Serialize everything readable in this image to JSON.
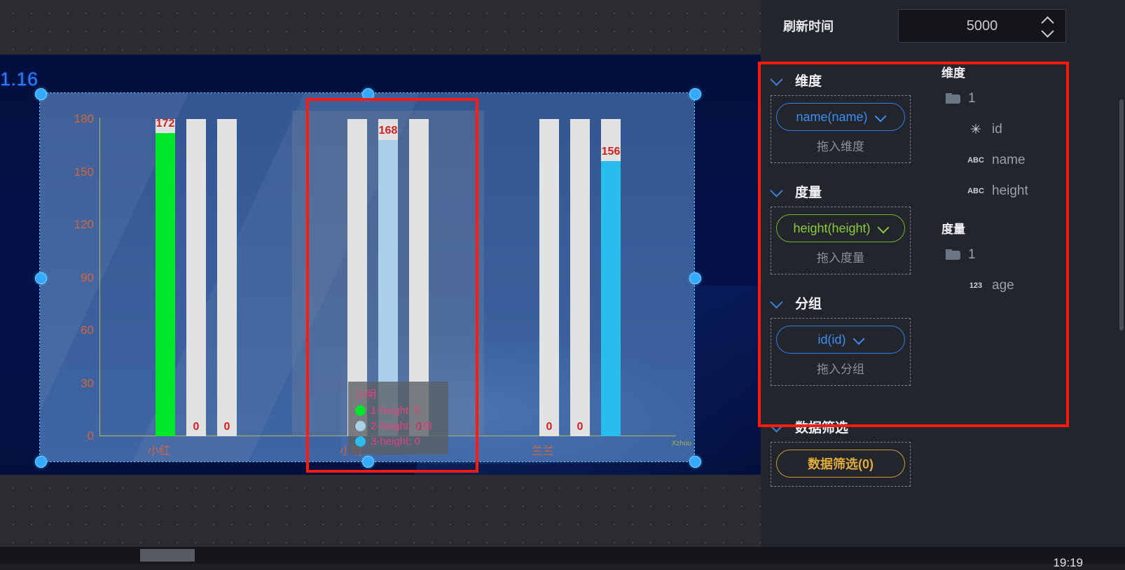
{
  "canvas": {
    "band_label": "1.16",
    "watermark": "Xzhou"
  },
  "chart_data": {
    "type": "bar",
    "title": "",
    "xlabel": "",
    "ylabel": "",
    "categories": [
      "小红",
      "小明",
      "兰兰"
    ],
    "series": [
      {
        "name": "1-height",
        "color": "#00e829",
        "values": [
          172,
          0,
          0
        ]
      },
      {
        "name": "2-height",
        "color": "#a9cfe9",
        "values": [
          0,
          168,
          0
        ]
      },
      {
        "name": "3-height",
        "color": "#29bdee",
        "values": [
          0,
          0,
          156
        ]
      }
    ],
    "yticks": [
      0,
      30,
      60,
      90,
      120,
      150,
      180
    ],
    "ylim": [
      0,
      180
    ],
    "grid": false,
    "bar_labels": [
      [
        "172",
        "0",
        "0"
      ],
      [
        "0",
        "168",
        "0"
      ],
      [
        "0",
        "0",
        "156"
      ]
    ],
    "axis_color": "#b5bd4a",
    "tick_color": "#d4663c",
    "label_color": "#d42020",
    "track_color": "#e2e2e2",
    "plot_bg": "#3d63a0"
  },
  "tooltip": {
    "title": "小明",
    "rows": [
      {
        "dot": "#00e829",
        "text": "1-height: 0"
      },
      {
        "dot": "#a9cfe9",
        "text": "2-height: 168"
      },
      {
        "dot": "#29bdee",
        "text": "3-height: 0"
      }
    ]
  },
  "panel": {
    "refresh": {
      "label": "刷新时间",
      "value": "5000",
      "up_icon": "chevron-up-icon",
      "down_icon": "chevron-down-icon"
    },
    "sections": [
      {
        "key": "dimension",
        "title": "维度",
        "pill": "name(name)",
        "pill_style": "blue",
        "hint": "拖入维度"
      },
      {
        "key": "measure",
        "title": "度量",
        "pill": "height(height)",
        "pill_style": "green",
        "hint": "拖入度量"
      },
      {
        "key": "group",
        "title": "分组",
        "pill": "id(id)",
        "pill_style": "blue",
        "hint": "拖入分组"
      },
      {
        "key": "filter",
        "title": "数据筛选",
        "pill": "数据筛选(0)",
        "pill_style": "gold",
        "hint": ""
      }
    ],
    "fields": {
      "dimension_title": "维度",
      "dimension_folder": "1",
      "dimension_items": [
        {
          "type": "✳",
          "name": "id"
        },
        {
          "type": "ABC",
          "name": "name"
        },
        {
          "type": "ABC",
          "name": "height"
        }
      ],
      "measure_title": "度量",
      "measure_folder": "1",
      "measure_items": [
        {
          "type": "123",
          "name": "age"
        }
      ]
    }
  },
  "taskbar": {
    "clock": "19:19"
  },
  "colors": {
    "accent_red": "#ff1a10",
    "selection_blue": "#33aaff",
    "panel_bg": "#22252c"
  }
}
